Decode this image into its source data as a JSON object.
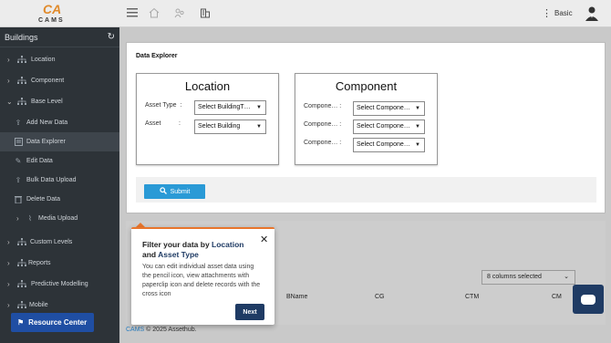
{
  "app": {
    "logo_mark": "CA",
    "logo_word": "CAMS",
    "user_name": "Basic"
  },
  "sidebar": {
    "header": "Buildings",
    "items": [
      {
        "label": "Location",
        "icon": "hierarchy-icon"
      },
      {
        "label": "Component",
        "icon": "hierarchy-icon"
      },
      {
        "label": "Base Level",
        "icon": "hierarchy-icon"
      },
      {
        "label": "Add New Data",
        "icon": "upload-icon"
      },
      {
        "label": "Data Explorer",
        "icon": "explorer-icon"
      },
      {
        "label": "Edit Data",
        "icon": "edit-icon"
      },
      {
        "label": "Bulk Data Upload",
        "icon": "upload-icon"
      },
      {
        "label": "Delete Data",
        "icon": "trash-icon"
      },
      {
        "label": "Media Upload",
        "icon": "paperclip-icon"
      },
      {
        "label": "Custom Levels",
        "icon": "hierarchy-icon"
      },
      {
        "label": "Reports",
        "icon": "hierarchy-icon"
      },
      {
        "label": "Predictive Modelling",
        "icon": "hierarchy-icon"
      },
      {
        "label": "Mobile",
        "icon": "hierarchy-icon"
      }
    ]
  },
  "resource_center": {
    "label": "Resource Center"
  },
  "explorer": {
    "title": "Data Explorer",
    "location": {
      "title": "Location",
      "asset_type_label": "Asset Type",
      "asset_type_value": "Select BuildingT…",
      "asset_label": "Asset",
      "asset_value": "Select Building"
    },
    "component": {
      "title": "Component",
      "rows": [
        {
          "label": "Compone…",
          "value": "Select Compone…"
        },
        {
          "label": "Compone…",
          "value": "Select Compone…"
        },
        {
          "label": "Compone…",
          "value": "Select Compone…"
        }
      ]
    },
    "submit_label": "Submit"
  },
  "table": {
    "columns_selected": "8 columns selected",
    "headers": [
      "BName",
      "CG",
      "CTM",
      "CM"
    ]
  },
  "footer": {
    "brand": "CAMS",
    "text": " © 2025 Assethub."
  },
  "popup": {
    "title_prefix": "Filter your data by ",
    "title_hl1": "Location",
    "title_mid": " and ",
    "title_hl2": "Asset Type",
    "body": "You can edit individual asset data using the pencil icon, view attachments with paperclip icon and delete records with the cross icon",
    "next_label": "Next"
  }
}
